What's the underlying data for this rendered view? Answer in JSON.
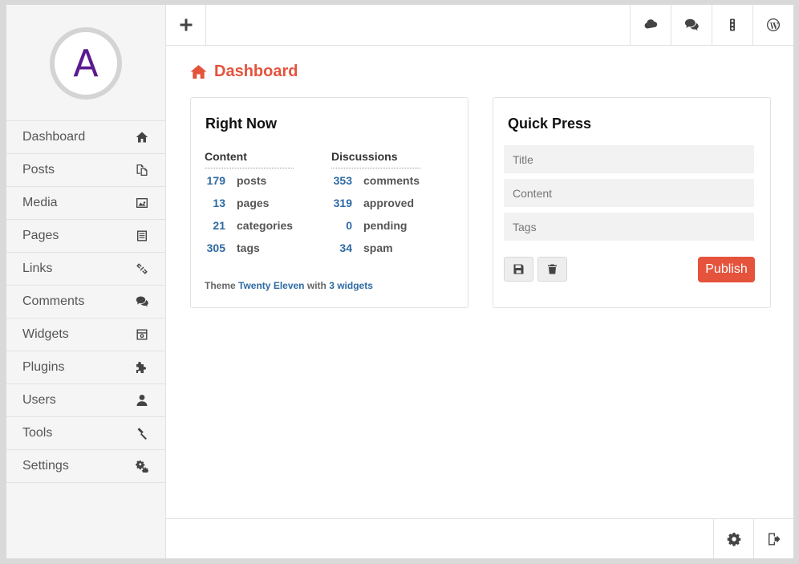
{
  "avatar": {
    "letter": "A"
  },
  "sidebar": {
    "items": [
      {
        "label": "Dashboard",
        "icon": "home-icon"
      },
      {
        "label": "Posts",
        "icon": "documents-icon"
      },
      {
        "label": "Media",
        "icon": "image-icon"
      },
      {
        "label": "Pages",
        "icon": "page-icon"
      },
      {
        "label": "Links",
        "icon": "link-icon"
      },
      {
        "label": "Comments",
        "icon": "comments-icon"
      },
      {
        "label": "Widgets",
        "icon": "widget-icon"
      },
      {
        "label": "Plugins",
        "icon": "puzzle-icon"
      },
      {
        "label": "Users",
        "icon": "user-icon"
      },
      {
        "label": "Tools",
        "icon": "hammer-icon"
      },
      {
        "label": "Settings",
        "icon": "gears-icon"
      }
    ]
  },
  "topbar": {
    "add": "plus-icon",
    "right": [
      "cloud-icon",
      "comments-icon",
      "traffic-light-icon",
      "wordpress-icon"
    ]
  },
  "bottombar": [
    "gear-icon",
    "logout-icon"
  ],
  "page": {
    "title": "Dashboard"
  },
  "right_now": {
    "title": "Right Now",
    "content_heading": "Content",
    "discussions_heading": "Discussions",
    "content": [
      {
        "num": "179",
        "label": "posts"
      },
      {
        "num": "13",
        "label": "pages"
      },
      {
        "num": "21",
        "label": "categories"
      },
      {
        "num": "305",
        "label": "tags"
      }
    ],
    "discussions": [
      {
        "num": "353",
        "label": "comments"
      },
      {
        "num": "319",
        "label": "approved"
      },
      {
        "num": "0",
        "label": "pending"
      },
      {
        "num": "34",
        "label": "spam"
      }
    ],
    "theme_prefix": "Theme",
    "theme_name": "Twenty Eleven",
    "theme_mid": "with",
    "widgets_link": "3 widgets"
  },
  "quick_press": {
    "title": "Quick Press",
    "title_placeholder": "Title",
    "content_placeholder": "Content",
    "tags_placeholder": "Tags",
    "publish_label": "Publish",
    "colors": {
      "publish": "#e5533c",
      "accent": "#e4533c",
      "link": "#2e6aa3"
    }
  }
}
